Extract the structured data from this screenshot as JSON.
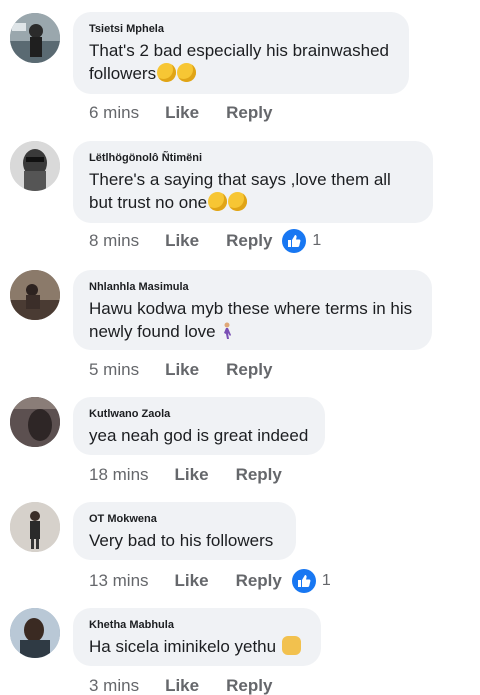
{
  "comments": [
    {
      "author": "Tsietsi Mphela",
      "text": "That's 2 bad especially his brainwashed followers",
      "emojis": [
        "thinking-emoji",
        "thinking-emoji"
      ],
      "time": "6 mins",
      "like_label": "Like",
      "reply_label": "Reply"
    },
    {
      "author": "Lëtlhögönolô Ñtimëni",
      "text": "There's a saying that says ,love them all but trust no one",
      "emojis": [
        "rofl-emoji",
        "rofl-emoji"
      ],
      "time": "8 mins",
      "like_label": "Like",
      "reply_label": "Reply",
      "reaction_count": "1"
    },
    {
      "author": "Nhlanhla Masimula",
      "text": "Hawu kodwa myb these where terms in his newly found love",
      "emojis": [
        "person-walking-emoji"
      ],
      "time": "5 mins",
      "like_label": "Like",
      "reply_label": "Reply"
    },
    {
      "author": "Kutlwano Zaola",
      "text": "yea neah god is great indeed",
      "time": "18 mins",
      "like_label": "Like",
      "reply_label": "Reply"
    },
    {
      "author": "OT Mokwena",
      "text": "Very bad to his followers",
      "time": "13 mins",
      "like_label": "Like",
      "reply_label": "Reply",
      "reaction_count": "1"
    },
    {
      "author": "Khetha Mabhula",
      "text": "Ha sicela iminikelo yethu",
      "emojis": [
        "open-hands-emoji"
      ],
      "time": "3 mins",
      "like_label": "Like",
      "reply_label": "Reply"
    }
  ],
  "colors": {
    "bubble": "#f0f2f5",
    "secondary_text": "#65676b",
    "like_blue": "#1877f2"
  }
}
